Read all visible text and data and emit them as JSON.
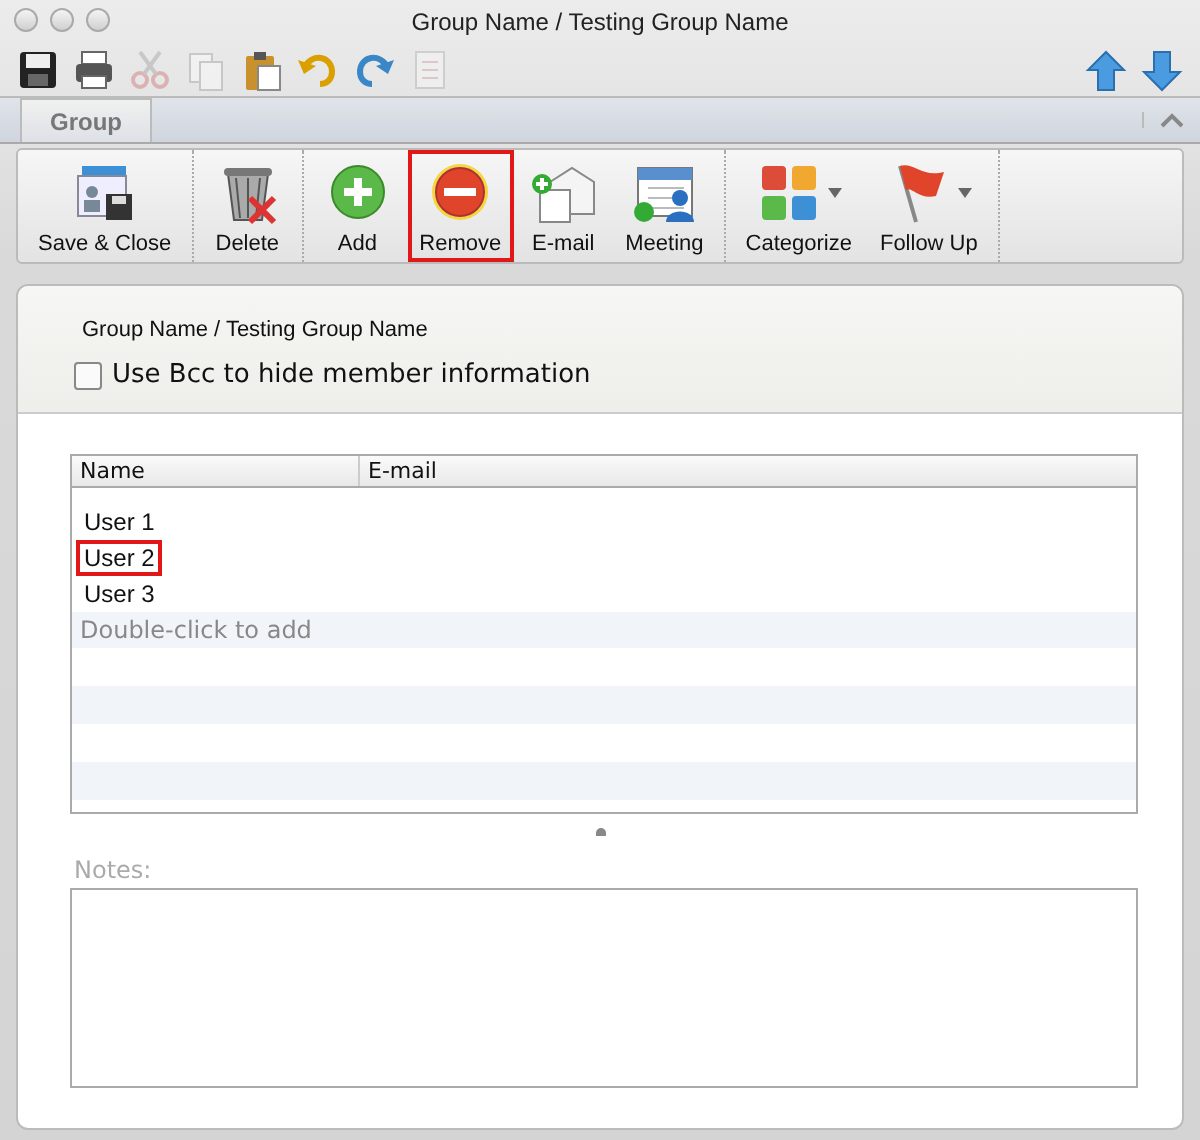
{
  "window": {
    "title": "Group Name / Testing Group Name"
  },
  "quick_toolbar": [
    {
      "kind": "save",
      "disabled": false
    },
    {
      "kind": "print",
      "disabled": false
    },
    {
      "kind": "cut",
      "disabled": true
    },
    {
      "kind": "copy",
      "disabled": true
    },
    {
      "kind": "paste",
      "disabled": false
    },
    {
      "kind": "undo",
      "disabled": false
    },
    {
      "kind": "redo",
      "disabled": false
    },
    {
      "kind": "form",
      "disabled": true
    }
  ],
  "nav_arrows": [
    {
      "kind": "up"
    },
    {
      "kind": "down"
    }
  ],
  "tabs": [
    {
      "label": "Group",
      "selected": true
    }
  ],
  "ribbon_groups": [
    [
      {
        "label": "Save & Close",
        "kind": "save-close",
        "highlighted": false,
        "dropdown": false
      }
    ],
    [
      {
        "label": "Delete",
        "kind": "delete",
        "highlighted": false,
        "dropdown": false
      }
    ],
    [
      {
        "label": "Add",
        "kind": "add",
        "highlighted": false,
        "dropdown": false
      },
      {
        "label": "Remove",
        "kind": "remove",
        "highlighted": true,
        "dropdown": false
      },
      {
        "label": "E-mail",
        "kind": "email",
        "highlighted": false,
        "dropdown": false
      },
      {
        "label": "Meeting",
        "kind": "meeting",
        "highlighted": false,
        "dropdown": false
      }
    ],
    [
      {
        "label": "Categorize",
        "kind": "categorize",
        "highlighted": false,
        "dropdown": true
      },
      {
        "label": "Follow Up",
        "kind": "flag",
        "highlighted": false,
        "dropdown": true
      }
    ]
  ],
  "header": {
    "group_name": "Group Name /  Testing Group Name",
    "bcc": {
      "label": "Use Bcc to hide member information",
      "checked": false
    }
  },
  "members": {
    "columns": [
      "Name",
      "E-mail"
    ],
    "rows": [
      {
        "name": "User 1",
        "highlighted": false
      },
      {
        "name": "User 2",
        "highlighted": true
      },
      {
        "name": "User 3",
        "highlighted": false
      }
    ],
    "placeholder": "Double-click to add"
  },
  "notes": {
    "label": "Notes:"
  }
}
